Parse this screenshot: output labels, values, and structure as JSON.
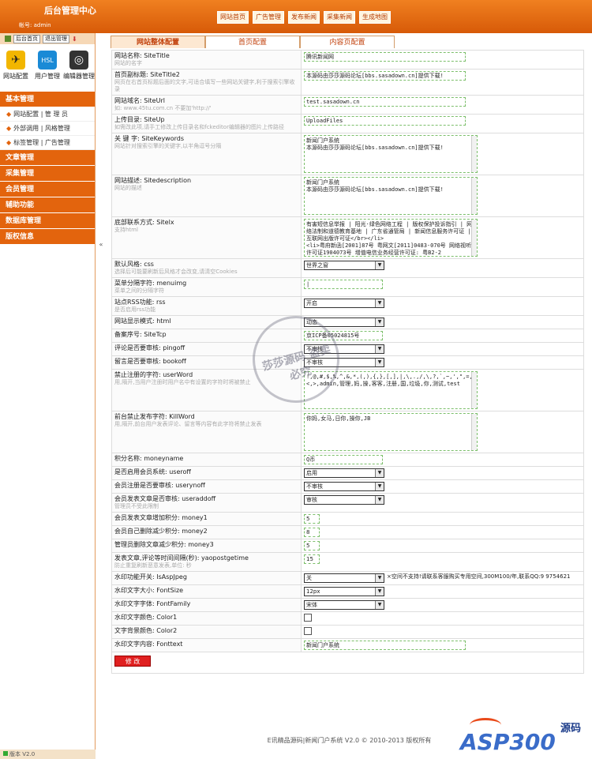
{
  "header": {
    "brand": "后台管理中心",
    "account": "帐号: admin",
    "nav": [
      "网站首页",
      "广告管理",
      "发布新闻",
      "采集新闻",
      "生成地图"
    ]
  },
  "sidebar": {
    "top_buttons": [
      "后台首页",
      "退出管理"
    ],
    "icons": [
      {
        "label": "网站配置",
        "icon": "bird-icon"
      },
      {
        "label": "用户管理",
        "icon": "user-icon"
      },
      {
        "label": "编辑器管理",
        "icon": "spiral-icon"
      }
    ],
    "sections": [
      {
        "title": "基本管理",
        "items": [
          "网站配置 | 管 理 员",
          "外部调用 | 风格管理",
          "标签管理 | 广告管理"
        ]
      },
      {
        "title": "文章管理"
      },
      {
        "title": "采集管理"
      },
      {
        "title": "会员管理"
      },
      {
        "title": "辅助功能"
      },
      {
        "title": "数据库管理"
      },
      {
        "title": "版权信息"
      }
    ],
    "footer": "版本 V2.0"
  },
  "tabs": [
    "网站整体配置",
    "首页配置",
    "内容页配置"
  ],
  "rows": [
    {
      "label": "网站名称: SiteTitle",
      "hint": "网站的名字",
      "type": "input",
      "value": "腾讯新闻网",
      "w": 205
    },
    {
      "label": "首页副标题: SiteTitle2",
      "hint": "网页在右首页标题后面的文字,可适合填写一些网站关键字,利于搜索引擎收录",
      "type": "input",
      "value": "本源码由莎莎源码论坛[bbs.sasadown.cn]提供下载!",
      "w": 205
    },
    {
      "label": "网站域名: SiteUrl",
      "hint": "如: www.45tu.com.cn 不要加'http://'",
      "type": "input",
      "value": "test.sasadown.cn",
      "w": 205
    },
    {
      "label": "上传目录: SiteUp",
      "hint": "如需改此项,请手工修改上传目录名和fckeditor编辑器的图片上传路径",
      "type": "input",
      "value": "UploadFiles",
      "w": 205
    },
    {
      "label": "关 键 字: SiteKeywords",
      "hint": "网站针对搜索引擎的关键字,以半角逗号分隔",
      "type": "textarea",
      "value": "新闻门户系统\n本源码由莎莎源码论坛[bbs.sasadown.cn]提供下载!",
      "h": 48
    },
    {
      "label": "网站描述: Sitedescription",
      "hint": "网站的描述",
      "type": "textarea",
      "value": "新闻门户系统\n本源码由莎莎源码论坛[bbs.sasadown.cn]提供下载!",
      "h": 48
    },
    {
      "label": "底部联系方式: Sitelx",
      "hint": "支持html",
      "type": "textarea",
      "value": "有害短信息举报 | 阳光·绿色网络工程 | 版权保护投诉指引 | 网络法制和道德教育基地 | 广东省通管局 | 新闻信息服务许可证 | 互联网出版许可证</br></li>\n<li>粤府新函[2001]87号 粤网文[2011]0483-070号 网络视听许可证1904073号 增值电信业务经营许可证: 粤B2-2",
      "h": 48
    },
    {
      "label": "默认风格: css",
      "hint": "选择后可能要刷新后风格才会改变,请清空Cookies",
      "type": "select",
      "value": "世界之窗"
    },
    {
      "label": "菜单分隔字符: menuimg",
      "hint": "菜单之间的分隔字符",
      "type": "input",
      "value": "|",
      "w": 100
    },
    {
      "label": "站点RSS功能: rss",
      "hint": "是否启用rss功能",
      "type": "select",
      "value": "开启"
    },
    {
      "label": "网站显示模式: html",
      "hint": "",
      "type": "select",
      "value": "动态"
    },
    {
      "label": "备案序号: SiteTcp",
      "hint": "",
      "type": "input",
      "value": "京ICP备05024815号",
      "w": 100
    },
    {
      "label": "评论是否要审核: pingoff",
      "hint": "",
      "type": "select",
      "value": "不审核"
    },
    {
      "label": "留言是否要审核: bookoff",
      "hint": "",
      "type": "select",
      "value": "不审核"
    },
    {
      "label": "禁止注册的字符: userWord",
      "hint": "用,隔开,当用户注册时用户名中有设置的字符时将被禁止",
      "type": "textarea",
      "value": "!,@,#,$,%,^,&,*,(,),{,},[,],|,\\,.,/,\\,?,`,~,',\",=,<,>,admin,管理,妈,操,客客,注册,国,垃圾,你,测试,test",
      "h": 48
    },
    {
      "label": "前台禁止发布字符: KillWord",
      "hint": "用,隔开,前台用户发表评论、留言等内容有此字符将禁止发表",
      "type": "textarea",
      "value": "你妈,女马,日你,操你,JB",
      "h": 48
    },
    {
      "label": "积分名称: moneyname",
      "hint": "",
      "type": "input",
      "value": "Q币",
      "w": 100
    },
    {
      "label": "是否启用会员系统: useroff",
      "hint": "",
      "type": "select",
      "value": "启用"
    },
    {
      "label": "会员注册是否要审核: userynoff",
      "hint": "",
      "type": "select",
      "value": "不审核"
    },
    {
      "label": "会员发表文章是否审核: useraddoff",
      "hint": "管理员不受此限制",
      "type": "select",
      "value": "审核"
    },
    {
      "label": "会员发表文章增加积分: money1",
      "hint": "",
      "type": "small",
      "value": "5"
    },
    {
      "label": "会员自己删除减少积分: money2",
      "hint": "",
      "type": "small",
      "value": "8"
    },
    {
      "label": "管理员删除文章减少积分: money3",
      "hint": "",
      "type": "small",
      "value": "5"
    },
    {
      "label": "发表文章,评论等时间间隔(秒): yaopostgetime",
      "hint": "防止重复刷新恶意发表,单位: 秒",
      "type": "small",
      "value": "15"
    },
    {
      "label": "水印功能开关: IsAspJpeg",
      "hint": "",
      "type": "select_note",
      "value": "关",
      "note": "×空间不支持!请联系客服购买专用空间,300M100/年,联系QQ:9 9754621"
    },
    {
      "label": "水印文字大小: FontSize",
      "hint": "",
      "type": "select",
      "value": "12px"
    },
    {
      "label": "水印文字字体: FontFamily",
      "hint": "",
      "type": "select",
      "value": "宋体"
    },
    {
      "label": "水印文字颜色: Color1",
      "hint": "",
      "type": "check"
    },
    {
      "label": "文字背景颜色: Color2",
      "hint": "",
      "type": "check"
    },
    {
      "label": "水印文字内容: Fonttext",
      "hint": "",
      "type": "input",
      "value": "新闻门户系统",
      "w": 205
    }
  ],
  "submit": "修 改",
  "footer": "E讯精品源码|新闻门户系统 V2.0 © 2010-2013 版权所有",
  "watermark": "莎莎源码 盗卖必究",
  "logo": {
    "text": "ASP300",
    "code": "源码"
  }
}
